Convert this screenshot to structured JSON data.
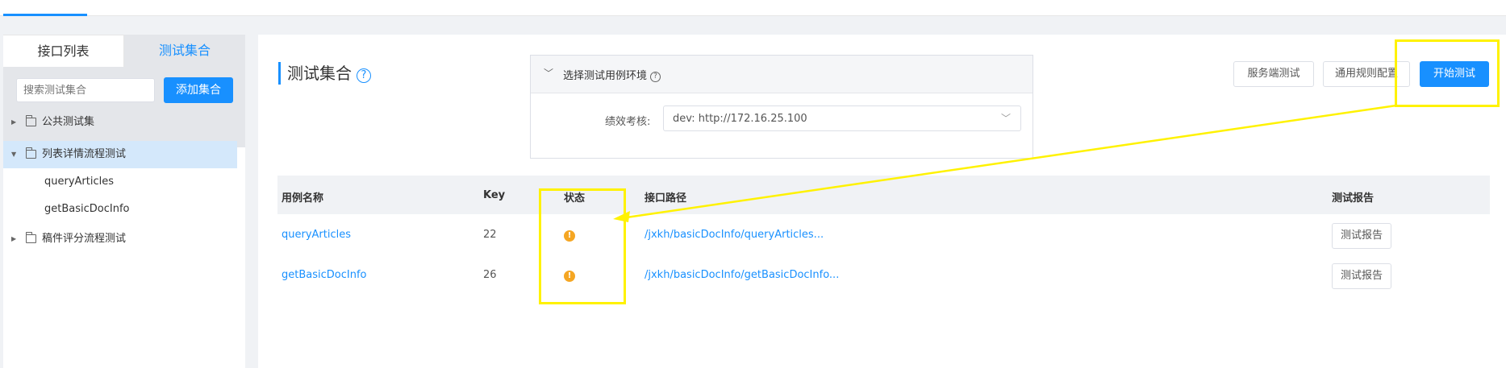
{
  "sidebar": {
    "tabs": [
      {
        "label": "接口列表"
      },
      {
        "label": "测试集合"
      }
    ],
    "search_placeholder": "搜索测试集合",
    "add_button": "添加集合",
    "tree": [
      {
        "label": "公共测试集"
      },
      {
        "label": "列表详情流程测试"
      },
      {
        "label": "queryArticles"
      },
      {
        "label": "getBasicDocInfo"
      },
      {
        "label": "稿件评分流程测试"
      }
    ]
  },
  "main": {
    "title": "测试集合",
    "title_help": "?",
    "env": {
      "title": "选择测试用例环境",
      "help": "?",
      "field_label": "绩效考核:",
      "select_value": "dev: http://172.16.25.100"
    },
    "buttons": {
      "server_test": "服务端测试",
      "general_rules": "通用规则配置",
      "start_test": "开始测试"
    },
    "table": {
      "headers": [
        "用例名称",
        "Key",
        "状态",
        "接口路径",
        "测试报告"
      ],
      "rows": [
        {
          "name": "queryArticles",
          "key": "22",
          "status": "!",
          "path": "/jxkh/basicDocInfo/queryArticles...",
          "report": "测试报告"
        },
        {
          "name": "getBasicDocInfo",
          "key": "26",
          "status": "!",
          "path": "/jxkh/basicDocInfo/getBasicDocInfo...",
          "report": "测试报告"
        }
      ]
    }
  },
  "colors": {
    "accent": "#1890ff",
    "status_warning": "#f5a623",
    "annotation": "#fff200",
    "selected_bg": "#d4e8fb"
  },
  "icons": {
    "title_help": "question-circle-icon",
    "env_toggle": "chevron-down-icon",
    "tree_folder": "folder-icon",
    "status": "exclamation-circle-icon"
  }
}
